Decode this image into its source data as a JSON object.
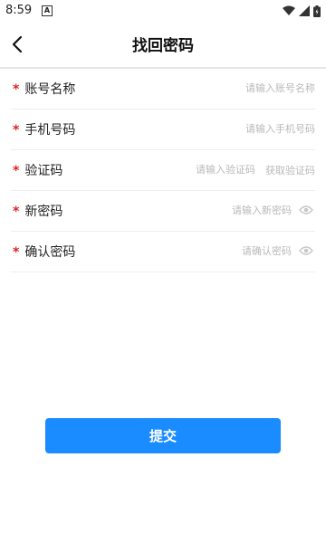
{
  "status_bar": {
    "time": "8:59",
    "notification_glyph": "A"
  },
  "header": {
    "title": "找回密码",
    "back_icon": "chevron-left-icon"
  },
  "form": {
    "required_mark": "*",
    "account": {
      "label": "账号名称",
      "placeholder": "请输入账号名称",
      "value": ""
    },
    "phone": {
      "label": "手机号码",
      "placeholder": "请输入手机号码",
      "value": ""
    },
    "code": {
      "label": "验证码",
      "placeholder": "请输入验证码",
      "value": "",
      "get_code": "获取验证码"
    },
    "new_password": {
      "label": "新密码",
      "placeholder": "请输入新密码",
      "value": ""
    },
    "confirm_password": {
      "label": "确认密码",
      "placeholder": "请确认密码",
      "value": ""
    }
  },
  "submit_label": "提交",
  "colors": {
    "accent": "#1a8cff",
    "required": "#e02020",
    "placeholder": "#b9b9b9"
  }
}
